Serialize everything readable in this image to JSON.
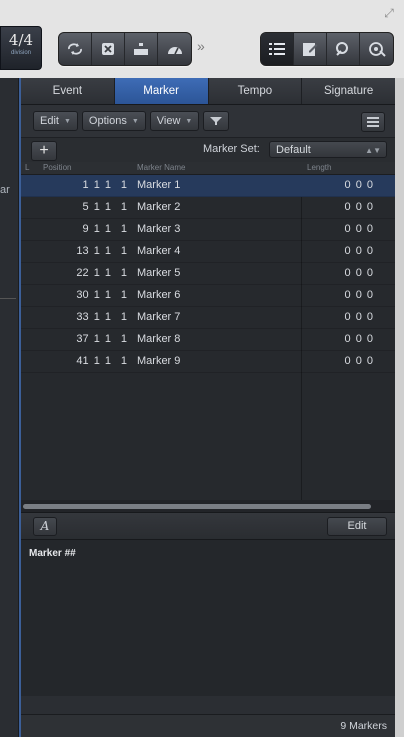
{
  "time_signature": {
    "value": "4/4",
    "sub": "division"
  },
  "top_tools": {
    "left_group": [
      "cycle-icon",
      "stop-icon",
      "metronome-icon",
      "tempo-icon"
    ],
    "more": "»",
    "right_group": [
      "list-editors-icon",
      "notepad-icon",
      "loop-browser-icon",
      "media-browser-icon"
    ]
  },
  "left_strip": {
    "text": "ar"
  },
  "tabs": [
    {
      "label": "Event",
      "active": false
    },
    {
      "label": "Marker",
      "active": true
    },
    {
      "label": "Tempo",
      "active": false
    },
    {
      "label": "Signature",
      "active": false
    }
  ],
  "toolbar": {
    "edit": "Edit",
    "options": "Options",
    "view": "View"
  },
  "marker_set": {
    "add": "+",
    "label": "Marker Set:",
    "value": "Default"
  },
  "columns": {
    "l": "L",
    "position": "Position",
    "marker_name": "Marker Name",
    "length": "Length"
  },
  "markers": [
    {
      "position": "1 1 1",
      "tick": "1",
      "name": "Marker 1",
      "length": "0 0 0",
      "selected": true
    },
    {
      "position": "5 1 1",
      "tick": "1",
      "name": "Marker 2",
      "length": "0 0 0"
    },
    {
      "position": "9 1 1",
      "tick": "1",
      "name": "Marker 3",
      "length": "0 0 0"
    },
    {
      "position": "13 1 1",
      "tick": "1",
      "name": "Marker 4",
      "length": "0 0 0"
    },
    {
      "position": "22 1 1",
      "tick": "1",
      "name": "Marker 5",
      "length": "0 0 0"
    },
    {
      "position": "30 1 1",
      "tick": "1",
      "name": "Marker 6",
      "length": "0 0 0"
    },
    {
      "position": "33 1 1",
      "tick": "1",
      "name": "Marker 7",
      "length": "0 0 0"
    },
    {
      "position": "37 1 1",
      "tick": "1",
      "name": "Marker 8",
      "length": "0 0 0"
    },
    {
      "position": "41 1 1",
      "tick": "1",
      "name": "Marker 9",
      "length": "0 0 0"
    }
  ],
  "note": {
    "font_button": "A",
    "edit_label": "Edit",
    "text": "Marker ##"
  },
  "status": {
    "count": "9 Markers"
  },
  "colors": {
    "accent": "#3e6cb6",
    "selected_row": "#263a5c",
    "panel_bg": "#26292d"
  }
}
